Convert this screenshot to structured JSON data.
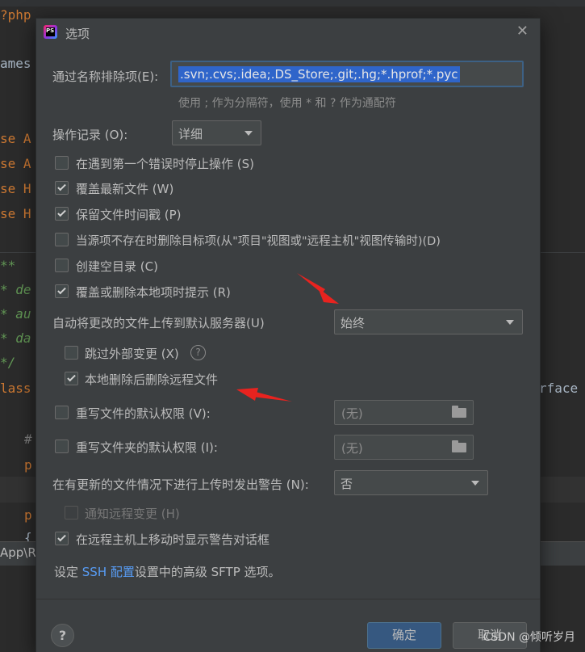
{
  "editor": {
    "lines": [
      {
        "text": "?php"
      },
      {
        "text": "ames"
      },
      {
        "text": "se A"
      },
      {
        "text": "se A"
      },
      {
        "text": "se H"
      },
      {
        "text": "se H"
      },
      {
        "text": "**"
      },
      {
        "text": "* de"
      },
      {
        "text": "* au"
      },
      {
        "text": "* da"
      },
      {
        "text": "*/"
      },
      {
        "text": "lass"
      },
      {
        "text": "#"
      },
      {
        "text": "p"
      },
      {
        "text": "p"
      },
      {
        "text": "{"
      }
    ],
    "right_fragment": "rface",
    "path_text": "App\\R"
  },
  "watermark": "CSDN @倾听岁月",
  "dialog": {
    "title": "选项",
    "app_icon_text": "PS",
    "exclude": {
      "label": "通过名称排除项(E):",
      "value": ".svn;.cvs;.idea;.DS_Store;.git;.hg;*.hprof;*.pyc",
      "hint": "使用 ; 作为分隔符，使用 * 和 ? 作为通配符"
    },
    "operation_log": {
      "label": "操作记录 (O):",
      "value": "详细"
    },
    "checkboxes": [
      {
        "label": "在遇到第一个错误时停止操作 (S)",
        "checked": false
      },
      {
        "label": "覆盖最新文件 (W)",
        "checked": true
      },
      {
        "label": "保留文件时间戳 (P)",
        "checked": true
      },
      {
        "label": "当源项不存在时删除目标项(从\"项目\"视图或\"远程主机\"视图传输时)(D)",
        "checked": false
      },
      {
        "label": "创建空目录 (C)",
        "checked": false
      },
      {
        "label": "覆盖或删除本地项时提示 (R)",
        "checked": true
      }
    ],
    "auto_upload": {
      "label": "自动将更改的文件上传到默认服务器(U)",
      "value": "始终"
    },
    "skip_external": {
      "label": "跳过外部变更 (X)",
      "checked": false,
      "help": "?"
    },
    "delete_remote": {
      "label": "本地删除后删除远程文件",
      "checked": true
    },
    "file_perms": {
      "label": "重写文件的默认权限 (V):",
      "checked": false,
      "value": "(无)"
    },
    "folder_perms": {
      "label": "重写文件夹的默认权限 (I):",
      "checked": false,
      "value": "(无)"
    },
    "warn_upload": {
      "label": "在有更新的文件情况下进行上传时发出警告 (N):",
      "value": "否"
    },
    "notify_remote": {
      "label": "通知远程变更 (H)",
      "checked": false,
      "disabled": true
    },
    "move_warning": {
      "label": "在远程主机上移动时显示警告对话框",
      "checked": true
    },
    "ssh_note": {
      "prefix": "设定 ",
      "link": "SSH 配置",
      "suffix": "设置中的高级 SFTP 选项。"
    },
    "footer": {
      "help": "?",
      "ok": "确定",
      "cancel": "取消"
    }
  },
  "colors": {
    "accent_red": "#e8231f",
    "selection": "#2f65ca",
    "ok_button": "#365880",
    "link": "#589df6"
  }
}
